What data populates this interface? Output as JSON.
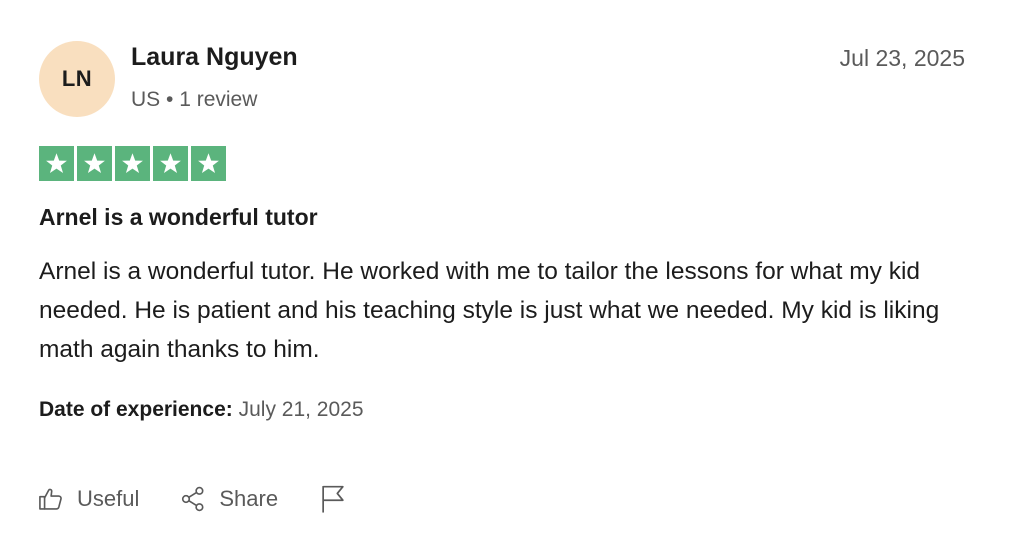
{
  "reviewer": {
    "initials": "LN",
    "name": "Laura Nguyen",
    "meta": "US • 1 review",
    "avatar_color": "#f9dfbf"
  },
  "review": {
    "date": "Jul 23, 2025",
    "rating": 5,
    "rating_max": 5,
    "star_color": "#5bb47d",
    "title": "Arnel is a wonderful tutor",
    "body": "Arnel is a wonderful tutor. He worked with me to tailor the lessons for what my kid needed. He is patient and his teaching style is just what we needed. My kid is liking math again thanks to him.",
    "experience_label": "Date of experience:",
    "experience_date": "July 21, 2025"
  },
  "actions": {
    "useful_label": "Useful",
    "useful_icon": "thumbs-up-icon",
    "share_label": "Share",
    "share_icon": "share-icon",
    "flag_icon": "flag-icon"
  }
}
